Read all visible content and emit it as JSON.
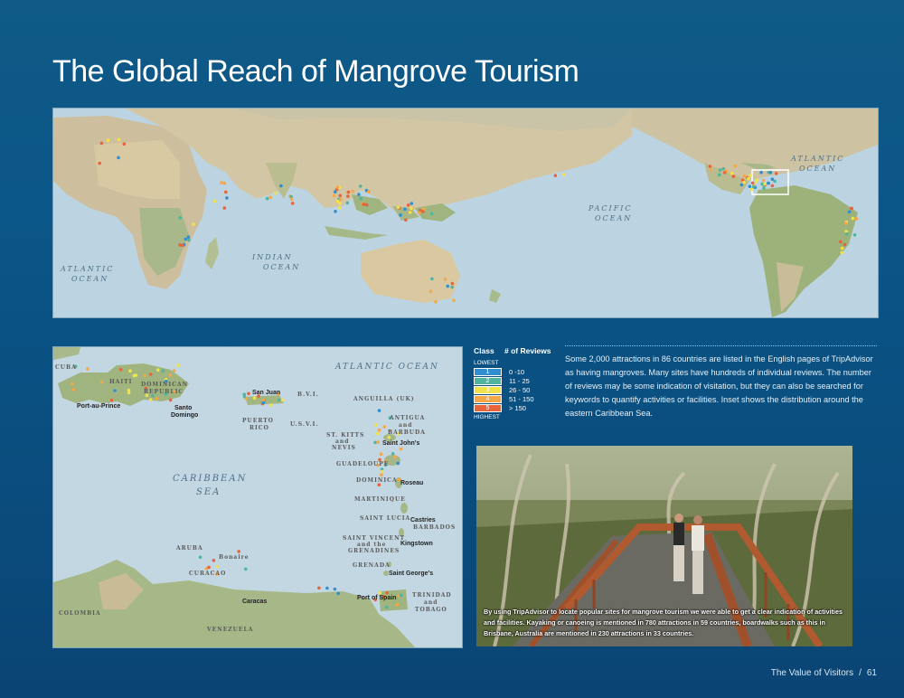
{
  "title": "The Global Reach of Mangrove Tourism",
  "world_map": {
    "ocean_labels": [
      "ATLANTIC",
      "OCEAN",
      "INDIAN",
      "OCEAN",
      "PACIFIC",
      "OCEAN",
      "ATLANTIC",
      "OCEAN"
    ]
  },
  "inset_map": {
    "ocean_labels": [
      "ATLANTIC  OCEAN",
      "CARIBBEAN",
      "SEA"
    ],
    "region_labels": [
      "CUBA",
      "HAITI",
      "DOMINICAN",
      "REPUBLIC",
      "PUERTO",
      "RICO",
      "B.V.I.",
      "U.S.V.I.",
      "ANGUILLA (UK)",
      "ANTIGUA",
      "and",
      "BARBUDA",
      "ST. KITTS",
      "and",
      "NEVIS",
      "GUADELOUPE",
      "DOMINICA",
      "MARTINIQUE",
      "SAINT LUCIA",
      "BARBADOS",
      "SAINT VINCENT",
      "and the",
      "GRENADINES",
      "GRENADA",
      "TRINIDAD",
      "and",
      "TOBAGO",
      "ARUBA",
      "Bonaire",
      "CURACAO",
      "COLOMBIA",
      "VENEZUELA"
    ],
    "city_labels": [
      "Port-au-Prince",
      "Santo",
      "Domingo",
      "San Juan",
      "Saint John's",
      "Roseau",
      "Castries",
      "Kingstown",
      "Saint George's",
      "Port of Spain",
      "Caracas"
    ]
  },
  "legend": {
    "class_header": "Class",
    "reviews_header": "# of Reviews",
    "lowest": "LOWEST",
    "highest": "HIGHEST",
    "classes": [
      {
        "class": "1",
        "range": "0 -10",
        "color": "#2f8fd0"
      },
      {
        "class": "2",
        "range": "11 - 25",
        "color": "#4fb59e"
      },
      {
        "class": "3",
        "range": "26 - 50",
        "color": "#f2e24a"
      },
      {
        "class": "4",
        "range": "51 - 150",
        "color": "#f5a646"
      },
      {
        "class": "5",
        "range": "> 150",
        "color": "#e8643a"
      }
    ]
  },
  "body_text": "Some 2,000 attractions in 86 countries are listed in the English pages of TripAdvisor as having mangroves. Many sites have hundreds of individual reviews. The number of reviews may be some indication of visitation, but they can also be searched for keywords to quantify activities or facilities. Inset shows the distribution around the eastern Caribbean Sea.",
  "photo_caption": "By using TripAdvisor to locate popular sites for mangrove tourism we were able to get a clear indication of activities and facilities. Kayaking or canoeing is mentioned in 780 attractions in 59 countries, boardwalks such as this in Brisbane, Australia are mentioned in 230 attractions in 33 countries.",
  "footer": {
    "section": "The Value of Visitors",
    "separator": "/",
    "page": "61"
  }
}
